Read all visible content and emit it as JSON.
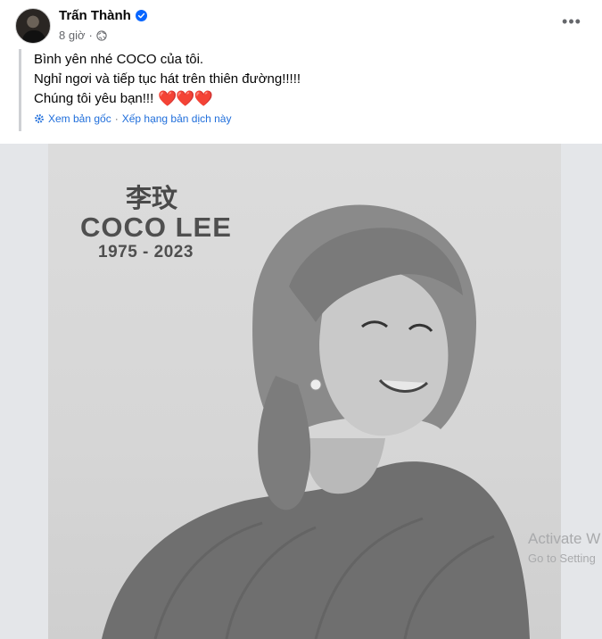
{
  "post": {
    "author": "Trấn Thành",
    "time": "8 giờ",
    "separator": "·",
    "more_label": "•••",
    "text_lines": [
      "Bình yên nhé COCO của tôi.",
      "Nghỉ ngơi và tiếp tục hát trên thiên đường!!!!!",
      "Chúng tôi yêu bạn!!!"
    ],
    "hearts": "❤️❤️❤️",
    "translation": {
      "see_original": "Xem bản gốc",
      "dot": "·",
      "rate": "Xếp hạng bản dịch này"
    }
  },
  "image": {
    "chinese_name": "李玟",
    "english_name": "COCO LEE",
    "years": "1975 - 2023"
  },
  "watermark": {
    "line1": "Activate W",
    "line2": "Go to Setting"
  },
  "colors": {
    "link": "#216fdb",
    "heart": "#e41e3f",
    "verified": "#0866ff"
  },
  "icons": {
    "verified": "verified-badge",
    "audience": "globe",
    "translate": "gear"
  }
}
